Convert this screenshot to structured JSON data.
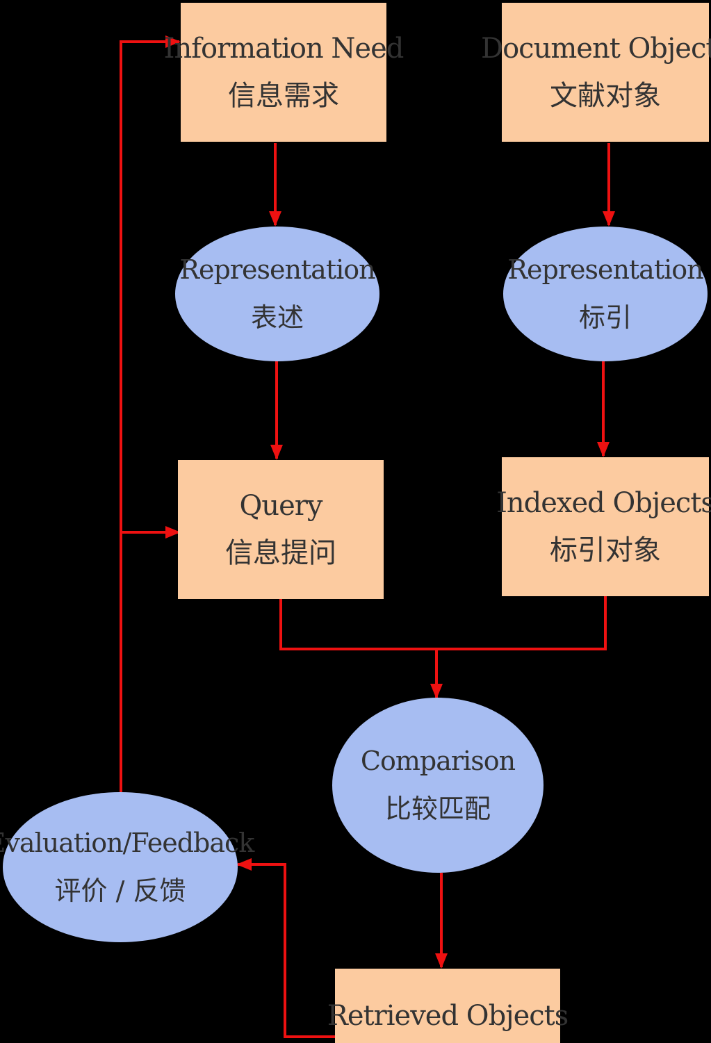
{
  "colors": {
    "background": "#000000",
    "box_fill": "#fccba0",
    "ellipse_fill": "#a7bdf2",
    "connector": "#ee1111",
    "text": "#333333"
  },
  "nodes": {
    "information_need": {
      "en": "Information Need",
      "zh": "信息需求"
    },
    "document_objects": {
      "en": "Document Objects",
      "zh": "文献对象"
    },
    "representation_query": {
      "en": "Representation",
      "zh": "表述"
    },
    "representation_doc": {
      "en": "Representation",
      "zh": "标引"
    },
    "query": {
      "en": "Query",
      "zh": "信息提问"
    },
    "indexed_objects": {
      "en": "Indexed Objects",
      "zh": "标引对象"
    },
    "comparison": {
      "en": "Comparison",
      "zh": "比较匹配"
    },
    "evaluation_feedback": {
      "en": "Evaluation/Feedback",
      "zh": "评价 / 反馈"
    },
    "retrieved_objects": {
      "en": "Retrieved Objects"
    }
  }
}
